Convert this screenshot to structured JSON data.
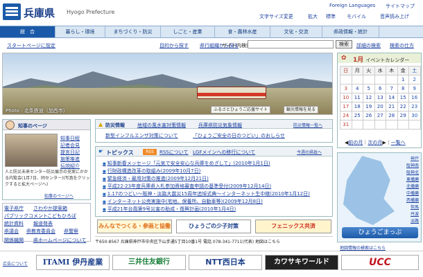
{
  "header": {
    "title": "兵庫県",
    "title_en": "Hyogo Prefecture",
    "links_top": [
      "Foreign Languages",
      "サイトマップ"
    ],
    "links_mid": [
      "文字サイズ変更",
      "拡大",
      "標準",
      "モバイル",
      "音声読み上げ"
    ]
  },
  "nav": {
    "items": [
      "総　合",
      "暮らし・環境",
      "まちづくり・防災",
      "しごと・産業",
      "食・農林水産",
      "文化・交流",
      "県政情報・統計"
    ]
  },
  "search_row": {
    "start_link": "スタートページに設定",
    "purpose_link": "目的から探す",
    "org_link": "県行組織から探す",
    "site_search_label": "サイト内検索",
    "search_button": "検索",
    "detail_search": "詳細の検索",
    "search_method": "検索の仕方"
  },
  "hero": {
    "caption": "Photo : 北条鉄道（加西市）",
    "buttons": [
      "ふるさとひょうご応援サイト",
      "観光情報を見る"
    ]
  },
  "calendar": {
    "month": "1",
    "title": "イベントカレンダー",
    "weekdays": [
      "日",
      "月",
      "火",
      "水",
      "木",
      "金",
      "土"
    ],
    "weeks": [
      [
        "",
        "",
        "",
        "",
        "",
        "1",
        "2"
      ],
      [
        "3",
        "4",
        "5",
        "6",
        "7",
        "8",
        "9"
      ],
      [
        "10",
        "11",
        "12",
        "13",
        "14",
        "15",
        "16"
      ],
      [
        "17",
        "18",
        "19",
        "20",
        "21",
        "22",
        "23"
      ],
      [
        "24",
        "25",
        "26",
        "27",
        "28",
        "29",
        "30"
      ],
      [
        "31",
        "",
        "",
        "",
        "",
        "",
        ""
      ]
    ],
    "prev": "前の月",
    "next": "次の月",
    "list": "一覧へ"
  },
  "map": {
    "cities": [
      "神戸",
      "阪神南",
      "阪神北",
      "東播磨",
      "北播磨",
      "中播磨",
      "西播磨",
      "但馬",
      "丹波",
      "淡路"
    ],
    "button": "ひょうごまっぷ",
    "note": "地図情報の検索はこちら"
  },
  "governor": {
    "title": "知事のページ",
    "links": [
      "知事日程",
      "記者会見",
      "提言日記",
      "施策推進",
      "伝説紹介"
    ],
    "text": "人と防災未来センター防災展示の充実にかかる内覧会(1月7日、同センター)(写真をクリックすると拡大ページへ)",
    "more": "知事のページへ"
  },
  "left_links": [
    "電子県庁",
    "さわやか提案箱",
    "パブリックコメント",
    "こどもひろば",
    "統計資料",
    "報道発表",
    "県議会",
    "県教育委員会",
    "県警察",
    "関係機関",
    "県ホームページについて"
  ],
  "bousai": {
    "title": "防災情報",
    "links": [
      "地域の風水害対策情報",
      "兵庫県防災気象情報"
    ],
    "more": "防災情報一覧へ",
    "item": "新型インフルエンザ対策について",
    "item2": "「ひょうご安全の日のつどい」のおしらせ"
  },
  "topics": {
    "title": "トピックス",
    "rss": "RSS",
    "rss_about": "RSSについて",
    "lg_link": "LGFメインへの移行について",
    "more": "今週の県政へ",
    "items": [
      "知事新春メッセージ「元気で安全安心な兵庫をめざして」(2010年1月1日)",
      "行財政構造改革の取組み(2009年10月7日)",
      "緊急経済・雇用対策の推進(2009年12月21日)",
      "平成22-23年度兵庫県入札参加資格審査申請の基準受付(2009年12月14日)",
      "1.17のつどい～阪神・淡路大震災15周年追悼式典～インターネット生中継(2010年1月12日)",
      "インターネット公売実施中(宅地、保養所、自動車等)(2009年12月8日)",
      "平成21年台風第9号災害の助成・復興計画(2010年1月4日)"
    ]
  },
  "banners": [
    "みんなでつくる・参画と協働",
    "ひょうごの少子対策",
    "フェニックス共済"
  ],
  "address": "〒650-8567 兵庫県神戸市中央区下山手通5丁目10番1号 電話 078-341-7711(代表)  地図はこちら",
  "ads": {
    "label": "広告について",
    "items": [
      "ITAMI 伊丹産業",
      "三井住友銀行",
      "NTT西日本",
      "カワサキワールド",
      "UCC"
    ]
  },
  "colors": {
    "brand": "#1b5aa8",
    "nav_bg": "#d9e6f3",
    "accent_red": "#c0392b",
    "rss": "#f08a24"
  }
}
